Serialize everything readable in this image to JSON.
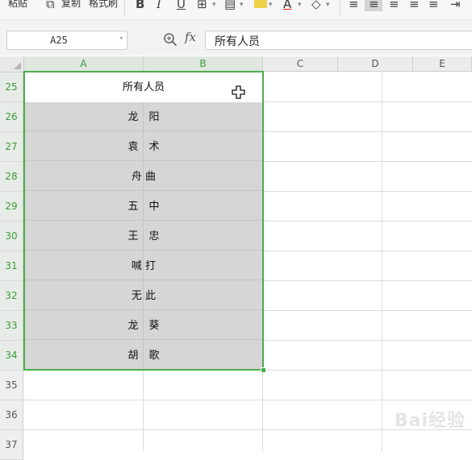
{
  "toolbar": {
    "paste_label": "粘贴",
    "copy_label": "复制",
    "format_painter_label": "格式刷",
    "bold_icon": "B",
    "italic_icon": "I",
    "underline_icon": "U"
  },
  "formula_bar": {
    "name_box": "A25",
    "fx_label": "fx",
    "formula": "所有人员"
  },
  "columns": [
    "A",
    "B",
    "C",
    "D",
    "E"
  ],
  "rows": [
    {
      "num": "25",
      "text": "所有人员"
    },
    {
      "num": "26",
      "text": "龙　阳"
    },
    {
      "num": "27",
      "text": "袁　术"
    },
    {
      "num": "28",
      "text": "舟 曲"
    },
    {
      "num": "29",
      "text": "五　中"
    },
    {
      "num": "30",
      "text": "王　忠"
    },
    {
      "num": "31",
      "text": "喊 打"
    },
    {
      "num": "32",
      "text": "无 此"
    },
    {
      "num": "33",
      "text": "龙　葵"
    },
    {
      "num": "34",
      "text": "胡　歌"
    },
    {
      "num": "35",
      "text": ""
    },
    {
      "num": "36",
      "text": ""
    },
    {
      "num": "37",
      "text": ""
    }
  ],
  "colors": {
    "selection_border": "#4bae4f",
    "selected_header_text": "#3a9b3a",
    "selection_fill": "#d6d6d6"
  }
}
